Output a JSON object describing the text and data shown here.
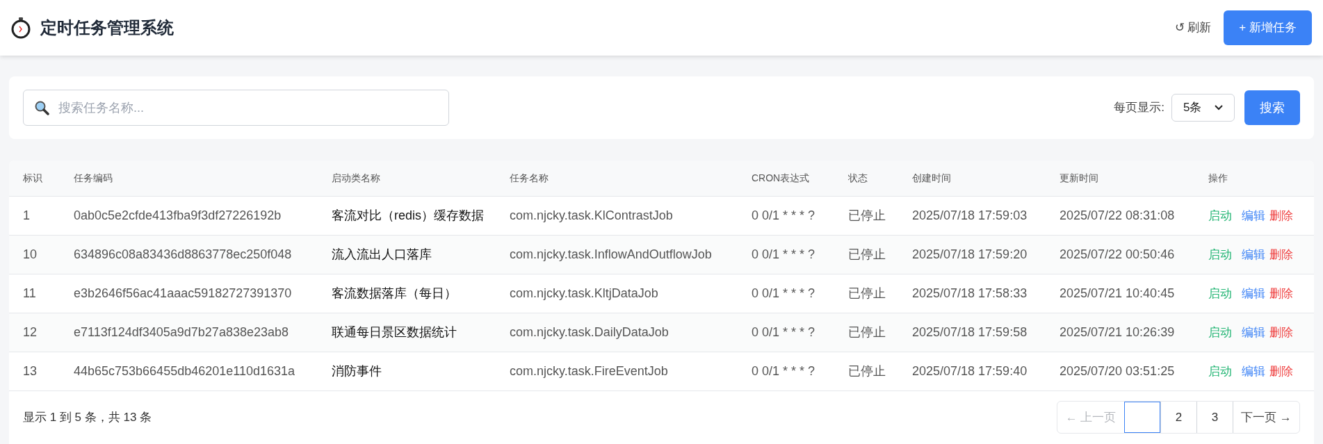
{
  "header": {
    "title": "定时任务管理系统",
    "refresh": "↺ 刷新",
    "add_button": "+ 新增任务"
  },
  "search": {
    "placeholder": "搜索任务名称...",
    "page_size_label": "每页显示:",
    "page_size": "5条",
    "button": "搜索"
  },
  "table": {
    "columns": [
      "标识",
      "任务编码",
      "启动类名称",
      "任务名称",
      "CRON表达式",
      "状态",
      "创建时间",
      "更新时间",
      "操作"
    ],
    "rows": [
      {
        "cells": [
          "1",
          "0ab0c5e2cfde413fba9f3df27226192b",
          "客流对比（redis）缓存数据",
          "com.njcky.task.KlContrastJob",
          "0 0/1 * * * ?",
          "已停止",
          "2025/07/18 17:59:03",
          "2025/07/22 08:31:08"
        ],
        "actions": [
          {
            "kind": "start",
            "label": "启动"
          },
          {
            "kind": "edit",
            "label": "编辑"
          },
          {
            "kind": "delete",
            "label": "删除"
          }
        ]
      },
      {
        "cells": [
          "10",
          "634896c08a83436d8863778ec250f048",
          "流入流出人口落库",
          "com.njcky.task.InflowAndOutflowJob",
          "0 0/1 * * * ?",
          "已停止",
          "2025/07/18 17:59:20",
          "2025/07/22 00:50:46"
        ],
        "actions": [
          {
            "kind": "start",
            "label": "启动"
          },
          {
            "kind": "edit",
            "label": "编辑"
          },
          {
            "kind": "delete",
            "label": "删除"
          }
        ]
      },
      {
        "cells": [
          "11",
          "e3b2646f56ac41aaac59182727391370",
          "客流数据落库（每日）",
          "com.njcky.task.KltjDataJob",
          "0 0/1 * * * ?",
          "已停止",
          "2025/07/18 17:58:33",
          "2025/07/21 10:40:45"
        ],
        "actions": [
          {
            "kind": "start",
            "label": "启动"
          },
          {
            "kind": "edit",
            "label": "编辑"
          },
          {
            "kind": "delete",
            "label": "删除"
          }
        ]
      },
      {
        "cells": [
          "12",
          "e7113f124df3405a9d7b27a838e23ab8",
          "联通每日景区数据统计",
          "com.njcky.task.DailyDataJob",
          "0 0/1 * * * ?",
          "已停止",
          "2025/07/18 17:59:58",
          "2025/07/21 10:26:39"
        ],
        "actions": [
          {
            "kind": "start",
            "label": "启动"
          },
          {
            "kind": "edit",
            "label": "编辑"
          },
          {
            "kind": "delete",
            "label": "删除"
          }
        ]
      },
      {
        "cells": [
          "13",
          "44b65c753b66455db46201e110d1631a",
          "消防事件",
          "com.njcky.task.FireEventJob",
          "0 0/1 * * * ?",
          "已停止",
          "2025/07/18 17:59:40",
          "2025/07/20 03:51:25"
        ],
        "actions": [
          {
            "kind": "start",
            "label": "启动"
          },
          {
            "kind": "edit",
            "label": "编辑"
          },
          {
            "kind": "delete",
            "label": "删除"
          }
        ]
      }
    ]
  },
  "footer": {
    "summary": "显示 1 到 5 条，共 13 条",
    "prev": {
      "label": "← 上一页",
      "disabled": true
    },
    "pages": [
      {
        "selected": true
      },
      {
        "label": "2",
        "selected": false
      },
      {
        "label": "3",
        "selected": false
      }
    ],
    "next": {
      "label": "下一页 →",
      "disabled": false
    }
  }
}
